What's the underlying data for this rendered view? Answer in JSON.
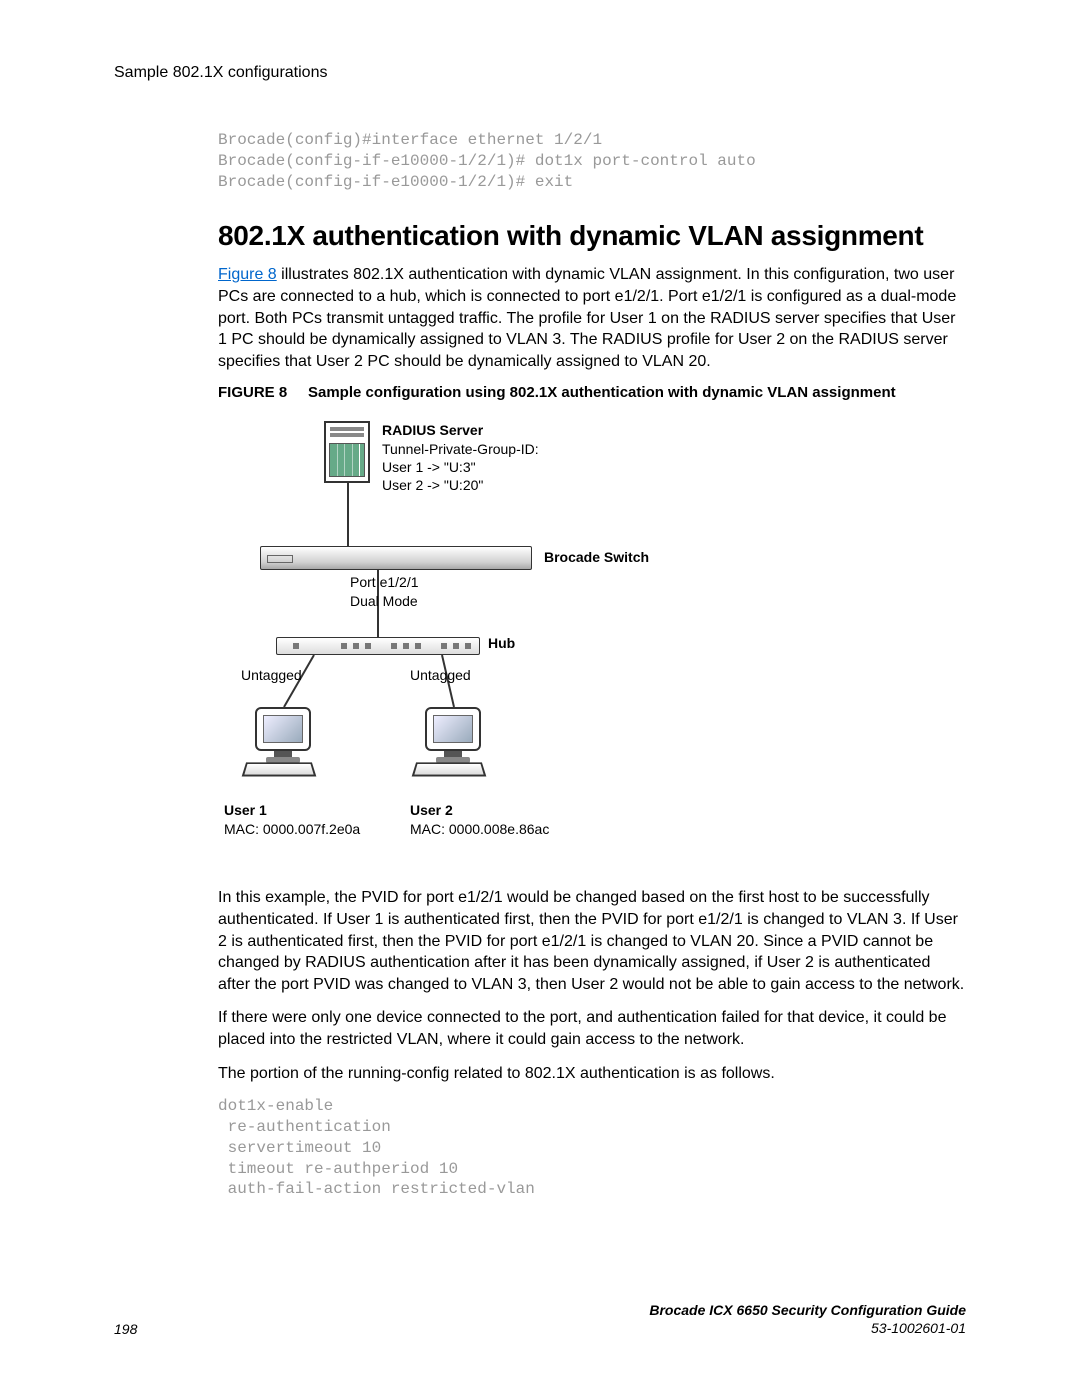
{
  "running_header": "Sample 802.1X configurations",
  "code_block_1": "Brocade(config)#interface ethernet 1/2/1\nBrocade(config-if-e10000-1/2/1)# dot1x port-control auto\nBrocade(config-if-e10000-1/2/1)# exit",
  "heading": "802.1X authentication with dynamic VLAN assignment",
  "intro_link": "Figure 8",
  "intro_rest": " illustrates 802.1X authentication with dynamic VLAN assignment. In this configuration, two user PCs are connected to a hub, which is connected to port e1/2/1. Port e1/2/1 is configured as a dual-mode port. Both PCs transmit untagged traffic. The profile for User 1 on the RADIUS server specifies that User 1 PC should be dynamically assigned to VLAN 3. The RADIUS profile for User 2 on the RADIUS server specifies that User 2 PC should be dynamically assigned to VLAN 20.",
  "figure_num": "FIGURE 8",
  "figure_caption": "Sample configuration using 802.1X authentication with dynamic VLAN assignment",
  "diagram": {
    "radius_title": "RADIUS Server",
    "radius_line1": "Tunnel-Private-Group-ID:",
    "radius_line2": "User 1 -> \"U:3\"",
    "radius_line3": "User 2 -> \"U:20\"",
    "switch_label": "Brocade Switch",
    "port_line1": "Port e1/2/1",
    "port_line2": "Dual Mode",
    "hub_label": "Hub",
    "untagged": "Untagged",
    "user1_title": "User 1",
    "user1_mac": "MAC: 0000.007f.2e0a",
    "user2_title": "User 2",
    "user2_mac": "MAC: 0000.008e.86ac"
  },
  "para2": "In this example, the PVID for port e1/2/1 would be changed based on the first host to be successfully authenticated. If User 1 is authenticated first, then the PVID for port e1/2/1 is changed to VLAN 3. If User 2 is authenticated first, then the PVID for port e1/2/1 is changed to VLAN 20. Since a PVID cannot be changed by RADIUS authentication after it has been dynamically assigned, if User 2 is authenticated after the port PVID was changed to VLAN 3, then User 2 would not be able to gain access to the network.",
  "para3": "If there were only one device connected to the port, and authentication failed for that device, it could be placed into the restricted VLAN, where it could gain access to the network.",
  "para4": "The portion of the running-config related to 802.1X authentication is as follows.",
  "code_block_2": "dot1x-enable\n re-authentication\n servertimeout 10\n timeout re-authperiod 10\n auth-fail-action restricted-vlan",
  "footer": {
    "page": "198",
    "doc_title": "Brocade ICX 6650 Security Configuration Guide",
    "doc_num": "53-1002601-01"
  }
}
